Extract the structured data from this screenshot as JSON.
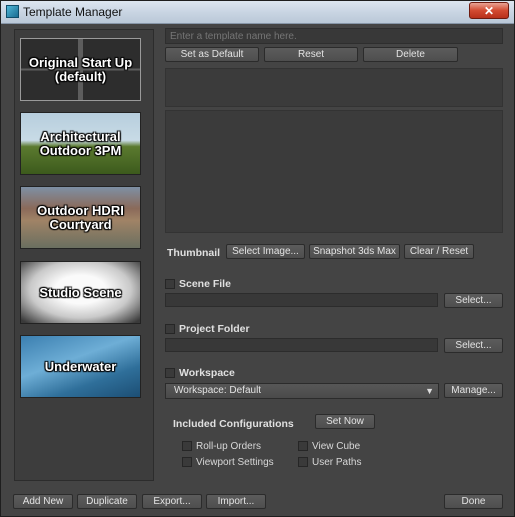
{
  "window": {
    "title": "Template Manager",
    "close_label": "✕"
  },
  "templates": [
    {
      "label": "Original Start Up (default)"
    },
    {
      "label": "Architectural Outdoor 3PM"
    },
    {
      "label": "Outdoor HDRI Courtyard"
    },
    {
      "label": "Studio Scene"
    },
    {
      "label": "Underwater"
    }
  ],
  "name_input": {
    "placeholder": "Enter a template name here."
  },
  "top_buttons": {
    "set_default": "Set as Default",
    "reset": "Reset",
    "delete": "Delete"
  },
  "thumbnail": {
    "label": "Thumbnail",
    "select_image": "Select Image...",
    "snapshot": "Snapshot 3ds Max",
    "clear_reset": "Clear / Reset"
  },
  "scene_file": {
    "label": "Scene File",
    "select": "Select..."
  },
  "project_folder": {
    "label": "Project Folder",
    "select": "Select..."
  },
  "workspace": {
    "label": "Workspace",
    "value": "Workspace: Default",
    "manage": "Manage..."
  },
  "included": {
    "label": "Included Configurations",
    "set_now": "Set Now",
    "options": [
      "Roll-up Orders",
      "View Cube",
      "Viewport Settings",
      "User Paths"
    ]
  },
  "bottom_buttons": {
    "add_new": "Add New",
    "duplicate": "Duplicate",
    "export": "Export...",
    "import": "Import...",
    "done": "Done"
  }
}
